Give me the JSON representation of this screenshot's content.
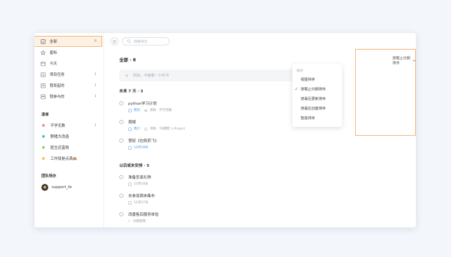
{
  "sidebar": {
    "items": [
      {
        "label": "全部",
        "count": "8"
      },
      {
        "label": "星标",
        "count": ""
      },
      {
        "label": "今天",
        "count": ""
      },
      {
        "label": "项目任务",
        "count": "1"
      },
      {
        "label": "我发起的",
        "count": "1"
      },
      {
        "label": "我参与的",
        "count": "1"
      }
    ],
    "list_section": "清单",
    "lists": [
      {
        "label": "不学无数",
        "count": "1",
        "color": "#f08a9a"
      },
      {
        "label": "野猪大改造",
        "count": "",
        "color": "#48c7b9"
      },
      {
        "label": "医生还蛮贱",
        "count": "",
        "color": "#95d27a"
      },
      {
        "label": "工作就是点滴🙈",
        "count": "",
        "color": "#f6c24f"
      }
    ],
    "team_section": "团队待办",
    "team": [
      {
        "label": "support_tb"
      }
    ]
  },
  "toolbar": {
    "search_placeholder": "搜索待办"
  },
  "main": {
    "title": "全部 · 8",
    "add_placeholder": "例如，今晚看一小时书",
    "sort_label": "按截止日期排序",
    "groups": [
      {
        "title": "未来 7 天 · 3",
        "tasks": [
          {
            "title": "python学习计划",
            "date": "明天",
            "date_color": "blue",
            "meta": "清单 · 不学无数"
          },
          {
            "title": "周报",
            "date": "周六",
            "date_color": "blue",
            "meta": "项目 · TB明明 's Project"
          },
          {
            "title": "督促《在航而飞》",
            "date": "12月18日",
            "date_color": "blue",
            "meta": ""
          }
        ]
      },
      {
        "title": "以后或未安排 · 5",
        "tasks": [
          {
            "title": "准备圣诞礼物",
            "date": "12月19日",
            "date_color": "gray",
            "meta": ""
          },
          {
            "title": "去参加周末集市",
            "date": "12月27日",
            "date_color": "gray",
            "meta": ""
          },
          {
            "title": "改善售后服务体验",
            "date": "",
            "date_color": "gray",
            "meta": "分配给我"
          }
        ]
      }
    ]
  },
  "sort_menu": {
    "header": "排序",
    "options": [
      {
        "label": "视图排序",
        "checked": false
      },
      {
        "label": "按截止日期排序",
        "checked": true
      },
      {
        "label": "按最近更新排序",
        "checked": false
      },
      {
        "label": "按最近创建排序",
        "checked": false
      },
      {
        "label": "智能排序",
        "checked": false
      }
    ]
  }
}
